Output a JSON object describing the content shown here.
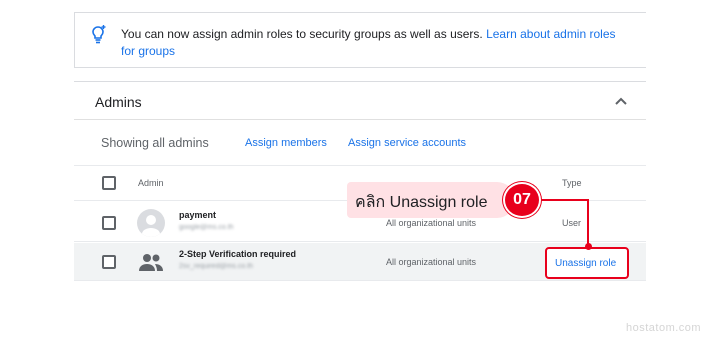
{
  "banner": {
    "icon": "lightbulb-icon",
    "message": "You can now assign admin roles to security groups as well as users. ",
    "link": "Learn about admin roles for groups"
  },
  "admins": {
    "title": "Admins",
    "collapse_icon": "chevron-up-icon",
    "showing_label": "Showing all admins",
    "assign_members": "Assign members",
    "assign_service_accounts": "Assign service accounts",
    "columns": {
      "admin": "Admin",
      "type": "Type"
    },
    "rows": [
      {
        "name": "payment",
        "email": "google@ms.co.th",
        "scope": "All organizational units",
        "type": "User",
        "icon": "person-avatar-icon"
      },
      {
        "name": "2-Step Verification required",
        "email": "2sv_required@ms.co.th",
        "scope": "All organizational units",
        "action": "Unassign role",
        "icon": "group-icon"
      }
    ]
  },
  "callout": {
    "text": "คลิก Unassign role",
    "step": "07",
    "accent": "#e8001c",
    "fill": "#ffe1e5"
  },
  "watermark": "hostatom.com",
  "colors": {
    "link": "#1a73e8",
    "border": "#dadce0",
    "highlight_row": "#f1f3f4"
  }
}
